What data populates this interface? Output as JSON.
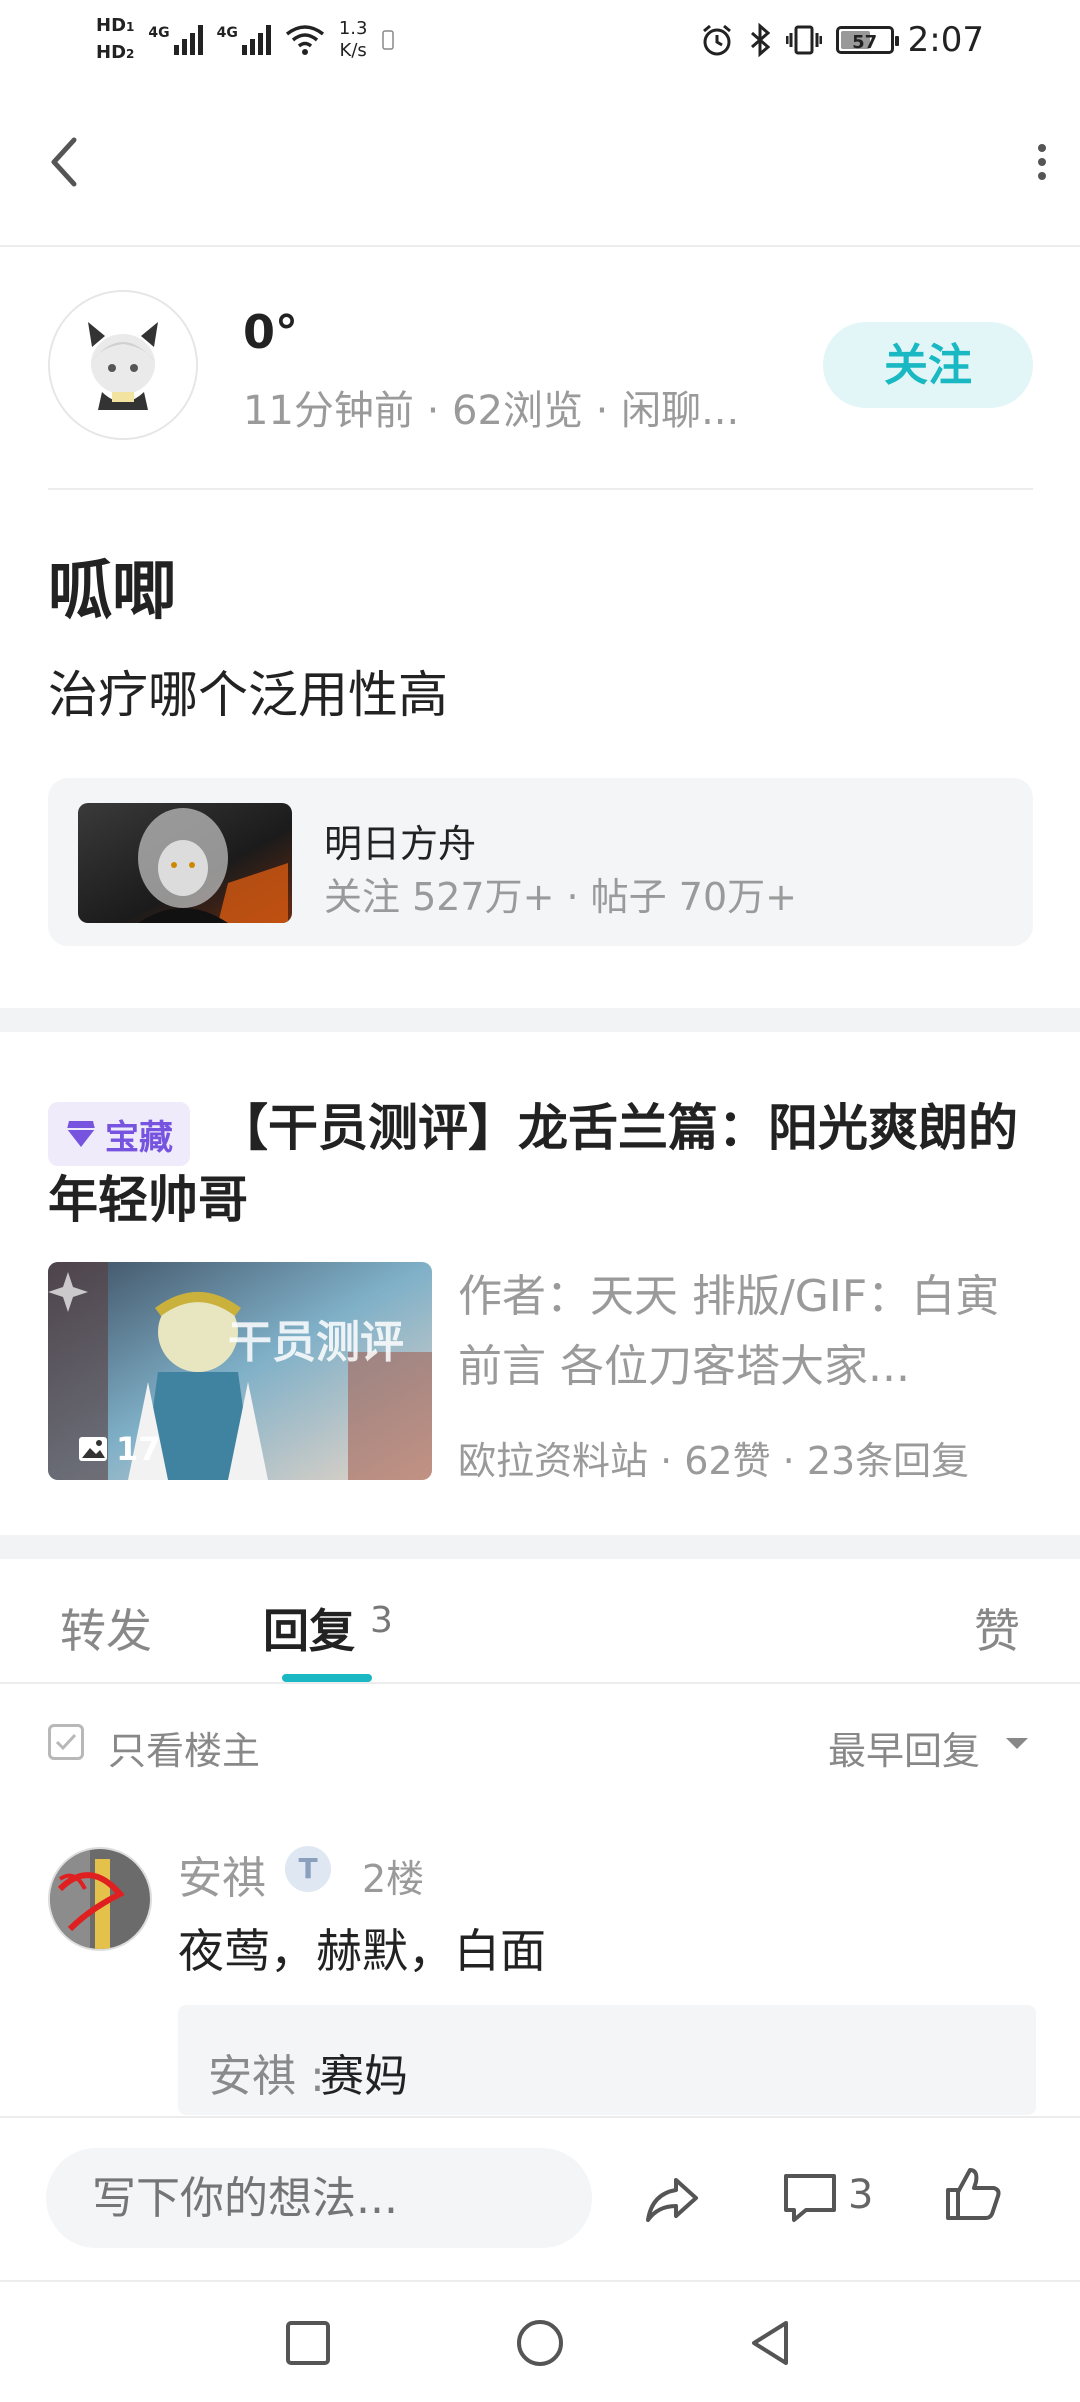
{
  "status_bar": {
    "hd1": "HD",
    "hd2": "HD",
    "sub1": "1",
    "sub2": "2",
    "sig1": "4G",
    "sig2": "4G",
    "speed_value": "1.3",
    "speed_unit": "K/s",
    "battery": "57",
    "time": "2:07",
    "icons": [
      "alarm-icon",
      "bluetooth-icon",
      "vibrate-icon",
      "battery-icon"
    ]
  },
  "author": {
    "name": "0°",
    "meta": "11分钟前 · 62浏览 · 闲聊...",
    "follow_label": "关注"
  },
  "post": {
    "title": "呱唧",
    "body": "治疗哪个泛用性高"
  },
  "forum": {
    "name": "明日方舟",
    "stats": "关注 527万+ · 帖子 70万+"
  },
  "linked_article": {
    "tag": "宝藏",
    "title": "【干员测评】龙舌兰篇：阳光爽朗的年轻帅哥",
    "image_count": "17",
    "excerpt": "作者：天天 排版/GIF：白寅 前言 各位刀客塔大家...",
    "meta": "欧拉资料站 · 62赞 · 23条回复"
  },
  "tabs": {
    "forward": "转发",
    "reply": "回复",
    "reply_count": "3",
    "like": "赞"
  },
  "filter": {
    "only_op": "只看楼主",
    "sort": "最早回复"
  },
  "comment": {
    "user": "安祺",
    "badge": "T",
    "floor": "2楼",
    "text": "夜莺，赫默，白面",
    "sub_user": "安祺 :",
    "sub_text": "赛妈"
  },
  "composer": {
    "placeholder": "写下你的想法...",
    "comment_count": "3"
  },
  "colors": {
    "accent": "#19b8c2",
    "tag_purple": "#7654e0"
  }
}
